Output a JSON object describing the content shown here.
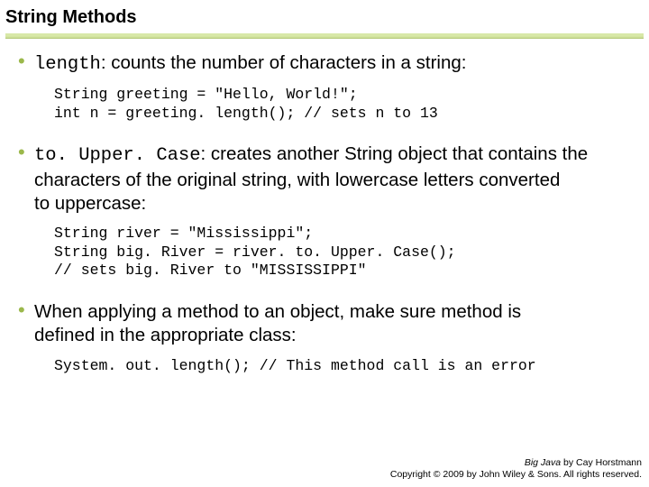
{
  "title": "String Methods",
  "bullets": {
    "b1": {
      "methodName": "length",
      "rest": ": counts the number of characters in a string:"
    },
    "b2": {
      "methodName": "to. Upper. Case",
      "rest_line1": ": creates another String object that contains the",
      "rest_line2": "characters of the original string, with lowercase letters converted",
      "rest_line3": "to uppercase:"
    },
    "b3": {
      "line1": "When applying a method to an object, make sure method is",
      "line2": "defined in the appropriate class:"
    }
  },
  "code": {
    "c1": "String greeting = \"Hello, World!\";\nint n = greeting. length(); // sets n to 13",
    "c2": "String river = \"Mississippi\";\nString big. River = river. to. Upper. Case();\n// sets big. River to \"MISSISSIPPI\"",
    "c3": "System. out. length(); // This method call is an error"
  },
  "footer": {
    "book": "Big Java",
    "author": " by Cay Horstmann",
    "copyright": "Copyright © 2009 by John Wiley & Sons. All rights reserved."
  }
}
